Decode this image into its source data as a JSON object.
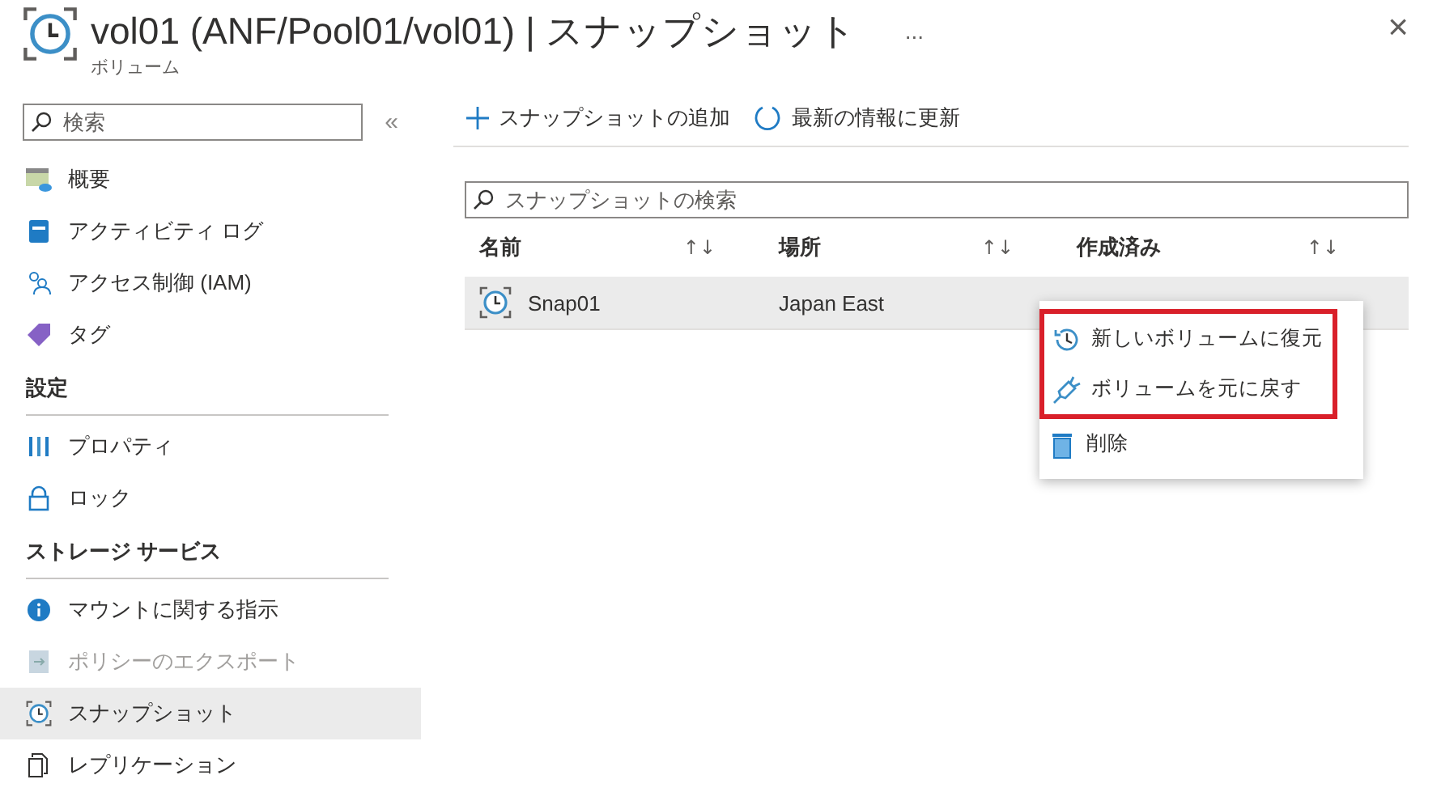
{
  "header": {
    "title": "vol01 (ANF/Pool01/vol01) | スナップショット",
    "subtitle": "ボリューム",
    "more": "...",
    "close": "×"
  },
  "sidebar": {
    "search": {
      "placeholder": "検索"
    },
    "collapse": "«",
    "entries": [
      {
        "kind": "item",
        "label": "概要",
        "selected": false,
        "disabled": false
      },
      {
        "kind": "item",
        "label": "アクティビティ ログ",
        "selected": false,
        "disabled": false
      },
      {
        "kind": "item",
        "label": "アクセス制御 (IAM)",
        "selected": false,
        "disabled": false
      },
      {
        "kind": "item",
        "label": "タグ",
        "selected": false,
        "disabled": false
      },
      {
        "kind": "section",
        "label": "設定"
      },
      {
        "kind": "item",
        "label": "プロパティ",
        "selected": false,
        "disabled": false
      },
      {
        "kind": "item",
        "label": "ロック",
        "selected": false,
        "disabled": false
      },
      {
        "kind": "section",
        "label": "ストレージ サービス"
      },
      {
        "kind": "item",
        "label": "マウントに関する指示",
        "selected": false,
        "disabled": false
      },
      {
        "kind": "item",
        "label": "ポリシーのエクスポート",
        "selected": false,
        "disabled": true
      },
      {
        "kind": "item",
        "label": "スナップショット",
        "selected": true,
        "disabled": false
      },
      {
        "kind": "item",
        "label": "レプリケーション",
        "selected": false,
        "disabled": false
      }
    ]
  },
  "toolbar": [
    {
      "label": "スナップショットの追加"
    },
    {
      "label": "最新の情報に更新"
    }
  ],
  "search": {
    "placeholder": "スナップショットの検索"
  },
  "table": {
    "columns": [
      {
        "label": "名前",
        "sort": "↑↓"
      },
      {
        "label": "場所",
        "sort": "↑↓"
      },
      {
        "label": "作成済み",
        "sort": "↑↓"
      }
    ],
    "rows": [
      {
        "name": "Snap01",
        "location": "Japan East",
        "selected": true
      }
    ]
  },
  "context_menu": {
    "items": [
      {
        "label": "新しいボリュームに復元",
        "highlighted": true
      },
      {
        "label": "ボリュームを元に戻す",
        "highlighted": true
      },
      {
        "label": "削除",
        "highlighted": false
      }
    ]
  }
}
